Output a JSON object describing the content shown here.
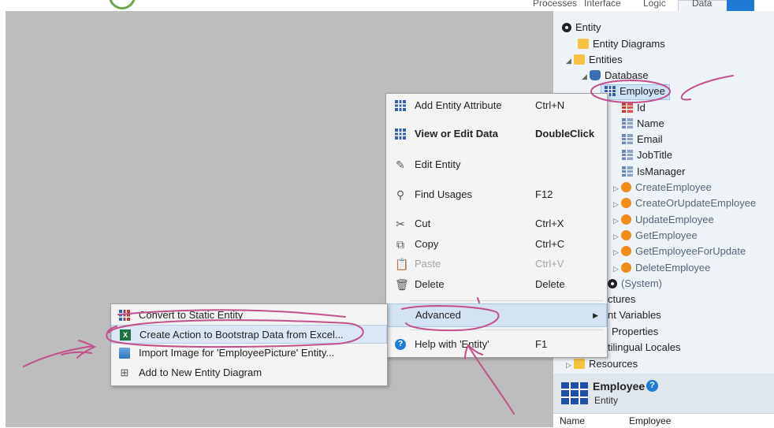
{
  "tabs": [
    "Processes",
    "Interface",
    "Logic",
    "Data"
  ],
  "tree": {
    "root": "Entity",
    "entity_diagrams": "Entity Diagrams",
    "entities": "Entities",
    "database": "Database",
    "employee": "Employee",
    "attributes": [
      "Id",
      "Name",
      "Email",
      "JobTitle",
      "IsManager"
    ],
    "actions": [
      "CreateEmployee",
      "CreateOrUpdateEmployee",
      "UpdateEmployee",
      "GetEmployee",
      "GetEmployeeForUpdate",
      "DeleteEmployee"
    ],
    "system": "(System)",
    "structures": "ctures",
    "site_variables": "nt Variables",
    "site_properties": "Properties",
    "locales": "tilingual Locales",
    "resources": "Resources"
  },
  "properties": {
    "title": "Employee",
    "subtitle": "Entity",
    "help": "?",
    "row_key": "Name",
    "row_value": "Employee"
  },
  "context_menu": {
    "add_attribute": {
      "label": "Add Entity Attribute",
      "shortcut": "Ctrl+N"
    },
    "view_data": {
      "label": "View or Edit Data",
      "shortcut": "DoubleClick"
    },
    "edit_entity": {
      "label": "Edit Entity"
    },
    "find_usages": {
      "label": "Find Usages",
      "shortcut": "F12"
    },
    "cut": {
      "label": "Cut",
      "shortcut": "Ctrl+X"
    },
    "copy": {
      "label": "Copy",
      "shortcut": "Ctrl+C"
    },
    "paste": {
      "label": "Paste",
      "shortcut": "Ctrl+V"
    },
    "delete": {
      "label": "Delete",
      "shortcut": "Delete"
    },
    "advanced": {
      "label": "Advanced"
    },
    "help": {
      "label": "Help with 'Entity'",
      "shortcut": "F1"
    }
  },
  "submenu": {
    "convert": "Convert to Static Entity",
    "bootstrap": "Create Action to Bootstrap Data from Excel...",
    "import_image": "Import Image for 'EmployeePicture' Entity...",
    "add_diagram": "Add to New Entity Diagram"
  },
  "colors": {
    "canvas": "#bdbdbd",
    "tree_bg": "#eef3f8",
    "accent_blue": "#1e7ad4",
    "annotation_pen": "#c2508a"
  }
}
